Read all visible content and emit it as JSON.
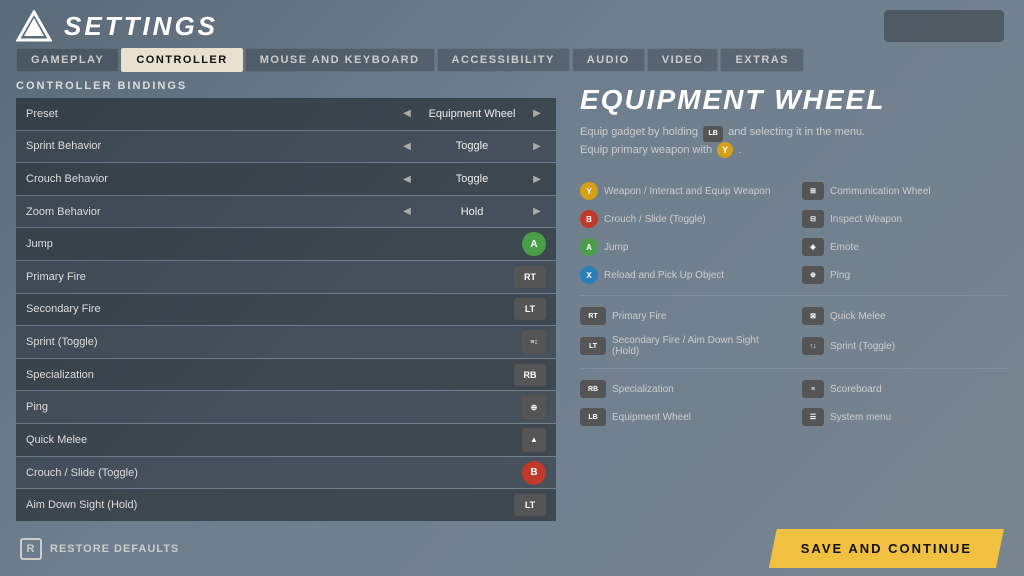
{
  "header": {
    "title": "SETTINGS",
    "logo_alt": "Apex Legends logo"
  },
  "tabs": [
    {
      "id": "gameplay",
      "label": "GAMEPLAY",
      "active": false
    },
    {
      "id": "controller",
      "label": "CONTROLLER",
      "active": true
    },
    {
      "id": "mouse_keyboard",
      "label": "MOUSE AND KEYBOARD",
      "active": false
    },
    {
      "id": "accessibility",
      "label": "ACCESSIBILITY",
      "active": false
    },
    {
      "id": "audio",
      "label": "AUDIO",
      "active": false
    },
    {
      "id": "video",
      "label": "VIDEO",
      "active": false
    },
    {
      "id": "extras",
      "label": "EXTRAS",
      "active": false
    }
  ],
  "section_title": "CONTROLLER BINDINGS",
  "bindings": [
    {
      "label": "Preset",
      "value": "Equipment Wheel",
      "type": "select"
    },
    {
      "label": "Sprint Behavior",
      "value": "Toggle",
      "type": "select"
    },
    {
      "label": "Crouch Behavior",
      "value": "Toggle",
      "type": "select"
    },
    {
      "label": "Zoom Behavior",
      "value": "Hold",
      "type": "select"
    },
    {
      "label": "Jump",
      "badge": "A",
      "badge_class": "btn-a"
    },
    {
      "label": "Primary Fire",
      "badge": "RT",
      "badge_class": "btn-rt"
    },
    {
      "label": "Secondary Fire",
      "badge": "LT",
      "badge_class": "btn-lt"
    },
    {
      "label": "Sprint (Toggle)",
      "badge": "↑↓",
      "badge_class": "btn-special"
    },
    {
      "label": "Specialization",
      "badge": "RB",
      "badge_class": "btn-rb"
    },
    {
      "label": "Ping",
      "badge": "⊕",
      "badge_class": "btn-special"
    },
    {
      "label": "Quick Melee",
      "badge": "↑",
      "badge_class": "btn-special"
    },
    {
      "label": "Crouch / Slide (Toggle)",
      "badge": "B",
      "badge_class": "btn-b"
    },
    {
      "label": "Aim Down Sight (Hold)",
      "badge": "LT",
      "badge_class": "btn-lt"
    }
  ],
  "equipment_wheel": {
    "title": "EQUIPMENT WHEEL",
    "desc_line1": "Equip gadget by holding",
    "desc_lb": "LB",
    "desc_line1b": "and selecting it in the menu.",
    "desc_line2": "Equip primary weapon with",
    "desc_y": "Y",
    "desc_line2b": ".",
    "grid_items": [
      {
        "badge": "Y",
        "badge_class": "badge-y badge-circle",
        "text": "Weapon / Interact and Equip Weapon"
      },
      {
        "badge": "⊞",
        "badge_class": "badge-special",
        "text": "Communication Wheel"
      },
      {
        "badge": "B",
        "badge_class": "badge-b badge-circle",
        "text": "Crouch / Slide (Toggle)"
      },
      {
        "badge": "⊟",
        "badge_class": "badge-special",
        "text": "Inspect Weapon"
      },
      {
        "badge": "A",
        "badge_class": "badge-a badge-circle",
        "text": "Jump"
      },
      {
        "badge": "◈",
        "badge_class": "badge-special",
        "text": "Emote"
      },
      {
        "badge": "X",
        "badge_class": "badge-x badge-circle",
        "text": "Reload and Pick Up Object"
      },
      {
        "badge": "⊕",
        "badge_class": "badge-special",
        "text": "Ping"
      },
      {
        "badge": "RT",
        "badge_class": "badge-rt",
        "text": "Primary Fire"
      },
      {
        "badge": "⊠",
        "badge_class": "badge-special",
        "text": "Quick Melee"
      },
      {
        "badge": "LT",
        "badge_class": "badge-lt",
        "text": "Secondary Fire / Aim Down Sight (Hold)"
      },
      {
        "badge": "↑↓",
        "badge_class": "badge-special",
        "text": "Sprint (Toggle)"
      },
      {
        "badge": "RB",
        "badge_class": "badge-rb",
        "text": "Specialization"
      },
      {
        "badge": "≡",
        "badge_class": "badge-special",
        "text": "Scoreboard"
      },
      {
        "badge": "LB",
        "badge_class": "badge-lb",
        "text": "Equipment Wheel"
      },
      {
        "badge": "☰",
        "badge_class": "badge-special",
        "text": "System menu"
      }
    ]
  },
  "footer": {
    "restore_r_label": "R",
    "restore_label": "RESTORE DEFAULTS",
    "save_label": "SAVE AND CONTINUE"
  }
}
